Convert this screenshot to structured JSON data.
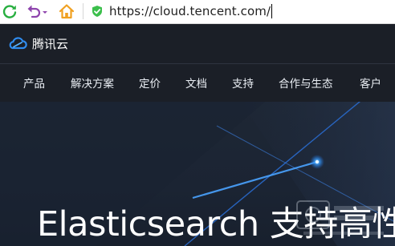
{
  "browser": {
    "url": "https://cloud.tencent.com/",
    "refresh_icon": "refresh-icon",
    "undo_icon": "undo-icon",
    "home_icon": "home-icon",
    "secure_icon": "shield-check-icon"
  },
  "site": {
    "logo_text": "腾讯云",
    "nav": [
      "产品",
      "解决方案",
      "定价",
      "文档",
      "支持",
      "合作与生态",
      "客户"
    ]
  },
  "hero": {
    "title": "Elasticsearch 支持高性"
  },
  "colors": {
    "header_bg": "#1b1f27",
    "hero_bg": "#1e2735",
    "accent_blue": "#2f8cf0",
    "refresh_green": "#27ae3f",
    "undo_purple": "#8e44ad",
    "home_orange": "#f0a020"
  }
}
